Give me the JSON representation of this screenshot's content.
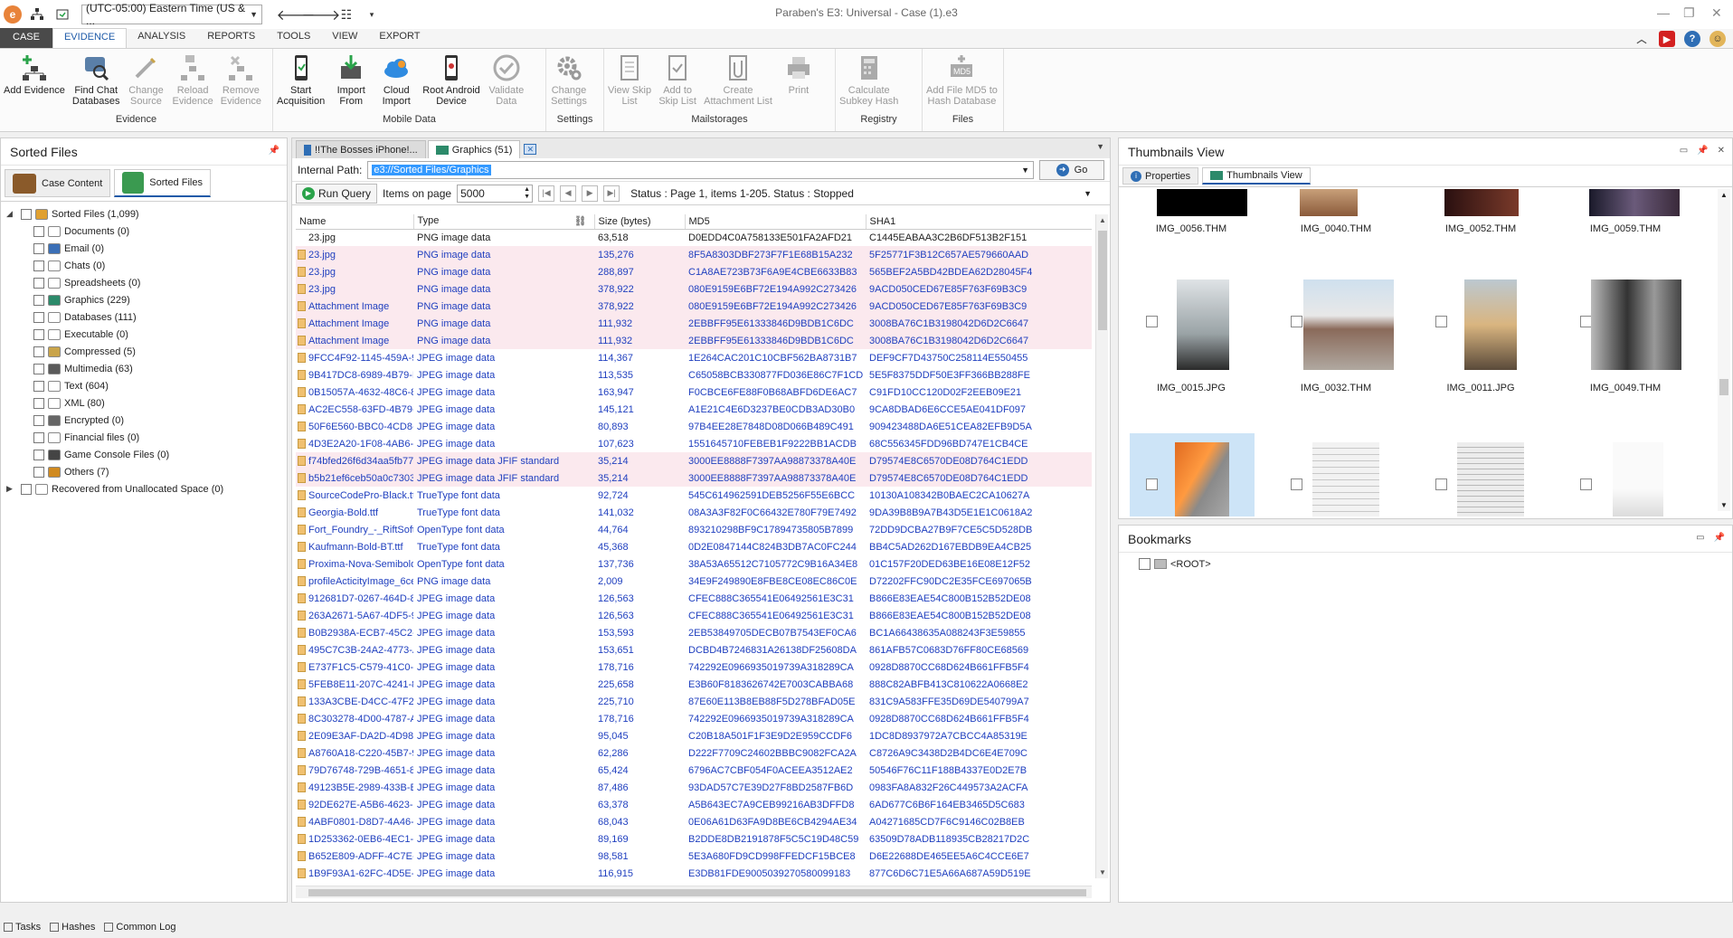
{
  "window": {
    "title": "Paraben's E3: Universal - Case (1).e3",
    "timezone": "(UTC-05:00) Eastern Time (US & ..."
  },
  "menu": {
    "tabs": [
      "CASE",
      "EVIDENCE",
      "ANALYSIS",
      "REPORTS",
      "TOOLS",
      "VIEW",
      "EXPORT"
    ],
    "active": "EVIDENCE"
  },
  "ribbon": {
    "groups": [
      {
        "label": "Evidence",
        "buttons": [
          {
            "line1": "Add Evidence",
            "line2": "",
            "icon": "add-evidence-icon",
            "enabled": true
          },
          {
            "line1": "Find Chat",
            "line2": "Databases",
            "icon": "find-chat-icon",
            "enabled": true
          },
          {
            "line1": "Change",
            "line2": "Source",
            "icon": "change-source-icon",
            "enabled": false
          },
          {
            "line1": "Reload",
            "line2": "Evidence",
            "icon": "reload-evidence-icon",
            "enabled": false
          },
          {
            "line1": "Remove",
            "line2": "Evidence",
            "icon": "remove-evidence-icon",
            "enabled": false
          }
        ]
      },
      {
        "label": "Mobile Data",
        "buttons": [
          {
            "line1": "Start",
            "line2": "Acquisition",
            "icon": "phone-icon",
            "enabled": true
          },
          {
            "line1": "Import",
            "line2": "From",
            "icon": "import-icon",
            "enabled": true
          },
          {
            "line1": "Cloud",
            "line2": "Import",
            "icon": "cloud-icon",
            "enabled": true
          },
          {
            "line1": "Root Android",
            "line2": "Device",
            "icon": "android-icon",
            "enabled": true
          },
          {
            "line1": "Validate",
            "line2": "Data",
            "icon": "validate-icon",
            "enabled": false
          }
        ]
      },
      {
        "label": "Settings",
        "buttons": [
          {
            "line1": "Change",
            "line2": "Settings",
            "icon": "gear-icon",
            "enabled": false
          }
        ]
      },
      {
        "label": "Mailstorages",
        "buttons": [
          {
            "line1": "View Skip",
            "line2": "List",
            "icon": "view-skip-icon",
            "enabled": false
          },
          {
            "line1": "Add to",
            "line2": "Skip List",
            "icon": "add-skip-icon",
            "enabled": false
          },
          {
            "line1": "Create",
            "line2": "Attachment List",
            "icon": "attachment-icon",
            "enabled": false
          },
          {
            "line1": "Print",
            "line2": "",
            "icon": "print-icon",
            "enabled": false
          }
        ]
      },
      {
        "label": "Registry",
        "buttons": [
          {
            "line1": "Calculate",
            "line2": "Subkey Hash",
            "icon": "calculator-icon",
            "enabled": false
          }
        ]
      },
      {
        "label": "Files",
        "buttons": [
          {
            "line1": "Add File MD5 to",
            "line2": "Hash Database",
            "icon": "md5-icon",
            "enabled": false
          }
        ]
      }
    ]
  },
  "left": {
    "title": "Sorted Files",
    "tabs": [
      "Case Content",
      "Sorted Files"
    ],
    "tree": [
      {
        "label": "Sorted Files (1,099)",
        "level": 0,
        "expand": "down",
        "color": "#e0a030"
      },
      {
        "label": "Documents (0)",
        "level": 1,
        "expand": "",
        "color": "#ffffff"
      },
      {
        "label": "Email (0)",
        "level": 1,
        "expand": "",
        "color": "#3b6fb6"
      },
      {
        "label": "Chats (0)",
        "level": 1,
        "expand": "",
        "color": "#ffffff"
      },
      {
        "label": "Spreadsheets (0)",
        "level": 1,
        "expand": "",
        "color": "#ffffff"
      },
      {
        "label": "Graphics (229)",
        "level": 1,
        "expand": "",
        "color": "#2c8a6a"
      },
      {
        "label": "Databases (111)",
        "level": 1,
        "expand": "",
        "color": "#ffffff"
      },
      {
        "label": "Executable (0)",
        "level": 1,
        "expand": "",
        "color": "#ffffff"
      },
      {
        "label": "Compressed (5)",
        "level": 1,
        "expand": "",
        "color": "#c9a44a"
      },
      {
        "label": "Multimedia (63)",
        "level": 1,
        "expand": "",
        "color": "#5a5a5a"
      },
      {
        "label": "Text (604)",
        "level": 1,
        "expand": "",
        "color": "#ffffff"
      },
      {
        "label": "XML (80)",
        "level": 1,
        "expand": "",
        "color": "#ffffff"
      },
      {
        "label": "Encrypted (0)",
        "level": 1,
        "expand": "",
        "color": "#666666"
      },
      {
        "label": "Financial files (0)",
        "level": 1,
        "expand": "",
        "color": "#ffffff"
      },
      {
        "label": "Game Console Files (0)",
        "level": 1,
        "expand": "",
        "color": "#444444"
      },
      {
        "label": "Others (7)",
        "level": 1,
        "expand": "",
        "color": "#d08a20"
      },
      {
        "label": "Recovered from Unallocated Space (0)",
        "level": 0,
        "expand": "right",
        "color": "#ffffff"
      }
    ]
  },
  "center": {
    "tabs": [
      "!!The Bosses iPhone!...",
      "Graphics (51)"
    ],
    "path_label": "Internal Path:",
    "path_value": "e3://Sorted Files/Graphics",
    "go_label": "Go",
    "run_query": "Run Query",
    "items_label": "Items on page",
    "items_value": "5000",
    "status": "Status : Page 1, items 1-205. Status : Stopped",
    "columns": [
      "Name",
      "Type",
      "Size (bytes)",
      "MD5",
      "SHA1"
    ],
    "rows": [
      [
        "23.jpg",
        "PNG image data",
        "63,518",
        "D0EDD4C0A758133E501FA2AFD21",
        "C1445EABAA3C2B6DF513B2F151"
      ],
      [
        "23.jpg",
        "PNG image data",
        "135,276",
        "8F5A8303DBF273F7F1E68B15A232",
        "5F25771F3B12C657AE579660AAD"
      ],
      [
        "23.jpg",
        "PNG image data",
        "288,897",
        "C1A8AE723B73F6A9E4CBE6633B83",
        "565BEF2A5BD42BDEA62D28045F4"
      ],
      [
        "23.jpg",
        "PNG image data",
        "378,922",
        "080E9159E6BF72E194A992C273426",
        "9ACD050CED67E85F763F69B3C9"
      ],
      [
        "Attachment Image",
        "PNG image data",
        "378,922",
        "080E9159E6BF72E194A992C273426",
        "9ACD050CED67E85F763F69B3C9"
      ],
      [
        "Attachment Image",
        "PNG image data",
        "111,932",
        "2EBBFF95E61333846D9BDB1C6DC",
        "3008BA76C1B3198042D6D2C6647"
      ],
      [
        "Attachment Image",
        "PNG image data",
        "111,932",
        "2EBBFF95E61333846D9BDB1C6DC",
        "3008BA76C1B3198042D6D2C6647"
      ],
      [
        "9FCC4F92-1145-459A-9",
        "JPEG image data",
        "114,367",
        "1E264CAC201C10CBF562BA8731B7",
        "DEF9CF7D43750C258114E550455"
      ],
      [
        "9B417DC8-6989-4B79-B",
        "JPEG image data",
        "113,535",
        "C65058BCB330877FD036E86C7F1CD",
        "5E5F8375DDF50E3FF366BB288FE"
      ],
      [
        "0B15057A-4632-48C6-8",
        "JPEG image data",
        "163,947",
        "F0CBCE6FE88F0B68ABFD6DE6AC7",
        "C91FD10CC120D02F2EEB09E21"
      ],
      [
        "AC2EC558-63FD-4B79-",
        "JPEG image data",
        "145,121",
        "A1E21C4E6D3237BE0CDB3AD30B0",
        "9CA8DBAD6E6CCE5AE041DF097"
      ],
      [
        "50F6E560-BBC0-4CD8-",
        "JPEG image data",
        "80,893",
        "97B4EE28E7848D08D066B489C491",
        "909423488DA6E51CEA82EFB9D5A"
      ],
      [
        "4D3E2A20-1F08-4AB6-",
        "JPEG image data",
        "107,623",
        "1551645710FEBEB1F9222BB1ACDB",
        "68C556345FDD96BD747E1CB4CE"
      ],
      [
        "f74bfed26f6d34aa5fb77d",
        "JPEG image data JFIF standard",
        "35,214",
        "3000EE8888F7397AA98873378A40E",
        "D79574E8C6570DE08D764C1EDD"
      ],
      [
        "b5b21ef6ceb50a0c7303f",
        "JPEG image data JFIF standard",
        "35,214",
        "3000EE8888F7397AA98873378A40E",
        "D79574E8C6570DE08D764C1EDD"
      ],
      [
        "SourceCodePro-Black.ttf",
        "TrueType font data",
        "92,724",
        "545C614962591DEB5256F55E6BCC",
        "10130A108342B0BAEC2CA10627A"
      ],
      [
        "Georgia-Bold.ttf",
        "TrueType font data",
        "141,032",
        "08A3A3F82F0C66432E780F79E7492",
        "9DA39B8B9A7B43D5E1E1C0618A2"
      ],
      [
        "Fort_Foundry_-_RiftSoft-",
        "OpenType font data",
        "44,764",
        "893210298BF9C17894735805B7899",
        "72DD9DCBA27B9F7CE5C5D528DB"
      ],
      [
        "Kaufmann-Bold-BT.ttf",
        "TrueType font data",
        "45,368",
        "0D2E0847144C824B3DB7AC0FC244",
        "BB4C5AD262D167EBDB9EA4CB25"
      ],
      [
        "Proxima-Nova-Semibold.",
        "OpenType font data",
        "137,736",
        "38A53A65512C7105772C9B16A34E8",
        "01C157F20DED63BE16E08E12F52"
      ],
      [
        "profileActicityImage_6ce",
        "PNG image data",
        "2,009",
        "34E9F249890E8FBE8CE08EC86C0E",
        "D72202FFC90DC2E35FCE697065B"
      ],
      [
        "912681D7-0267-464D-8",
        "JPEG image data",
        "126,563",
        "CFEC888C365541E06492561E3C31",
        "B866E83EAE54C800B152B52DE08"
      ],
      [
        "263A2671-5A67-4DF5-9",
        "JPEG image data",
        "126,563",
        "CFEC888C365541E06492561E3C31",
        "B866E83EAE54C800B152B52DE08"
      ],
      [
        "B0B2938A-ECB7-45C2-",
        "JPEG image data",
        "153,593",
        "2EB53849705DECB07B7543EF0CA6",
        "BC1A66438635A088243F3E59855"
      ],
      [
        "495C7C3B-24A2-4773-A",
        "JPEG image data",
        "153,651",
        "DCBD4B7246831A26138DF25608DA",
        "861AFB57C0683D76FF80CE68569"
      ],
      [
        "E737F1C5-C579-41C0-8",
        "JPEG image data",
        "178,716",
        "742292E0966935019739A318289CA",
        "0928D8870CC68D624B661FFB5F4"
      ],
      [
        "5FEB8E11-207C-4241-8",
        "JPEG image data",
        "225,658",
        "E3B60F8183626742E7003CABBA68",
        "888C82ABFB413C810622A0668E2"
      ],
      [
        "133A3CBE-D4CC-47F2-",
        "JPEG image data",
        "225,710",
        "87E60E113B8EB88F5D278BFAD05E",
        "831C9A583FFE35D69DE540799A7"
      ],
      [
        "8C303278-4D00-4787-A",
        "JPEG image data",
        "178,716",
        "742292E0966935019739A318289CA",
        "0928D8870CC68D624B661FFB5F4"
      ],
      [
        "2E09E3AF-DA2D-4D98-",
        "JPEG image data",
        "95,045",
        "C20B18A501F1F3E9D2E959CCDF6",
        "1DC8D8937972A7CBCC4A85319E"
      ],
      [
        "A8760A18-C220-45B7-9",
        "JPEG image data",
        "62,286",
        "D222F7709C24602BBBC9082FCA2A",
        "C8726A9C3438D2B4DC6E4E709C"
      ],
      [
        "79D76748-729B-4651-8",
        "JPEG image data",
        "65,424",
        "6796AC7CBF054F0ACEEA3512AE2",
        "50546F76C11F188B4337E0D2E7B"
      ],
      [
        "49123B5E-2989-433B-B",
        "JPEG image data",
        "87,486",
        "93DAD57C7E39D27F8BD2587FB6D",
        "0983FA8A832F26C449573A2ACFA"
      ],
      [
        "92DE627E-A5B6-4623-",
        "JPEG image data",
        "63,378",
        "A5B643EC7A9CEB99216AB3DFFD8",
        "6AD677C6B6F164EB3465D5C683"
      ],
      [
        "4ABF0801-D8D7-4A46-",
        "JPEG image data",
        "68,043",
        "0E06A61D63FA9D8BE6CB4294AE34",
        "A04271685CD7F6C9146C02B8EB"
      ],
      [
        "1D253362-0EB6-4EC1-",
        "JPEG image data",
        "89,169",
        "B2DDE8DB2191878F5C5C19D48C59",
        "63509D78ADB118935CB28217D2C"
      ],
      [
        "B652E809-ADFF-4C7E-",
        "JPEG image data",
        "98,581",
        "5E3A680FD9CD998FFEDCF15BCE8",
        "D6E22688DE465EE5A6C4CCE6E7"
      ],
      [
        "1B9F93A1-62FC-4D5E-",
        "JPEG image data",
        "116,915",
        "E3DB81FDE9005039270580099183",
        "877C6D6C71E5A66A687A59D519E"
      ]
    ]
  },
  "thumbs": {
    "title": "Thumbnails View",
    "tabs": [
      "Properties",
      "Thumbnails View"
    ],
    "row1": [
      "IMG_0056.THM",
      "IMG_0040.THM",
      "IMG_0052.THM",
      "IMG_0059.THM"
    ],
    "row2": [
      "IMG_0015.JPG",
      "IMG_0032.THM",
      "IMG_0011.JPG",
      "IMG_0049.THM"
    ]
  },
  "bookmarks": {
    "title": "Bookmarks",
    "root": "<ROOT>"
  },
  "bottom": [
    "Tasks",
    "Hashes",
    "Common Log"
  ]
}
